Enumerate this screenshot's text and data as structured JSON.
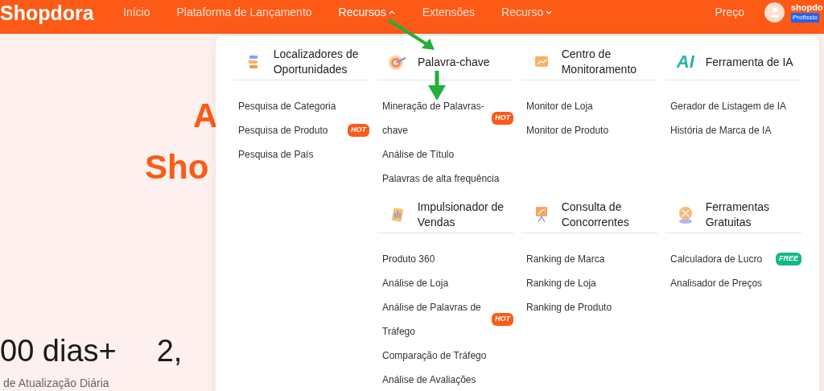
{
  "header": {
    "logo": "Shopdora",
    "nav": [
      {
        "label": "Início",
        "selected": false
      },
      {
        "label": "Plataforma de Lançamento",
        "selected": false
      },
      {
        "label": "Recursos",
        "selected": true,
        "expanded": true
      },
      {
        "label": "Extensões",
        "selected": false
      },
      {
        "label": "Recurso",
        "selected": false,
        "expanded": false
      }
    ],
    "pricing": "Preço",
    "user": {
      "name": "shopdo",
      "plan": "Profissio"
    }
  },
  "hero": {
    "title_lines": [
      "A",
      "Sho"
    ],
    "stats": [
      {
        "value": "00 dias+",
        "label": "de Atualização Diária"
      },
      {
        "value": "2,"
      }
    ]
  },
  "dropdown": {
    "sections": [
      {
        "title": "Localizadores de Oportunidades",
        "items": [
          {
            "label": "Pesquisa de Categoria"
          },
          {
            "label": "Pesquisa de Produto",
            "badge": "HOT"
          },
          {
            "label": "Pesquisa de País"
          }
        ]
      },
      {
        "title": "Palavra-chave",
        "items": [
          {
            "label": "Mineração de Palavras-chave",
            "badge": "HOT"
          },
          {
            "label": "Análise de Título"
          },
          {
            "label": "Palavras de alta frequência"
          }
        ]
      },
      {
        "title": "Centro de Monitoramento",
        "items": [
          {
            "label": "Monitor de Loja"
          },
          {
            "label": "Monitor de Produto"
          }
        ]
      },
      {
        "title": "Ferramenta de IA",
        "icon_text": "AI",
        "items": [
          {
            "label": "Gerador de Listagem de IA"
          },
          {
            "label": "História de Marca de IA"
          }
        ]
      },
      {
        "title": "Impulsionador de Vendas",
        "items": [
          {
            "label": "Produto 360"
          },
          {
            "label": "Análise de Loja"
          },
          {
            "label": "Análise de Palavras de Tráfego",
            "badge": "HOT"
          },
          {
            "label": "Comparação de Tráfego"
          },
          {
            "label": "Análise de Avaliações"
          }
        ]
      },
      {
        "title": "Consulta de Concorrentes",
        "items": [
          {
            "label": "Ranking de Marca"
          },
          {
            "label": "Ranking de Loja"
          },
          {
            "label": "Ranking de Produto"
          }
        ]
      },
      {
        "title": "Ferramentas Gratuitas",
        "items": [
          {
            "label": "Calculadora de Lucro",
            "badge": "FREE"
          },
          {
            "label": "Analisador de Preços"
          }
        ]
      }
    ]
  }
}
